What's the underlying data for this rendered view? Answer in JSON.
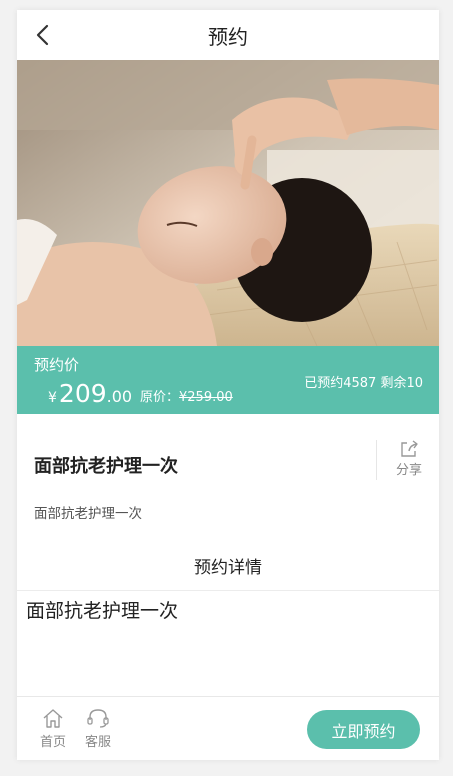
{
  "header": {
    "title": "预约"
  },
  "price_bar": {
    "label": "预约价",
    "currency": "¥",
    "price_int": "209",
    "price_dec": ".00",
    "orig_label": "原价：",
    "orig_price": "¥259.00",
    "stats": "已预约4587 剩余10"
  },
  "product": {
    "name": "面部抗老护理一次",
    "share_label": "分享",
    "desc": "面部抗老护理一次"
  },
  "details": {
    "title": "预约详情",
    "text": "面部抗老护理一次"
  },
  "footer": {
    "home_label": "首页",
    "service_label": "客服",
    "book_label": "立即预约"
  },
  "colors": {
    "accent": "#5bbfac"
  }
}
